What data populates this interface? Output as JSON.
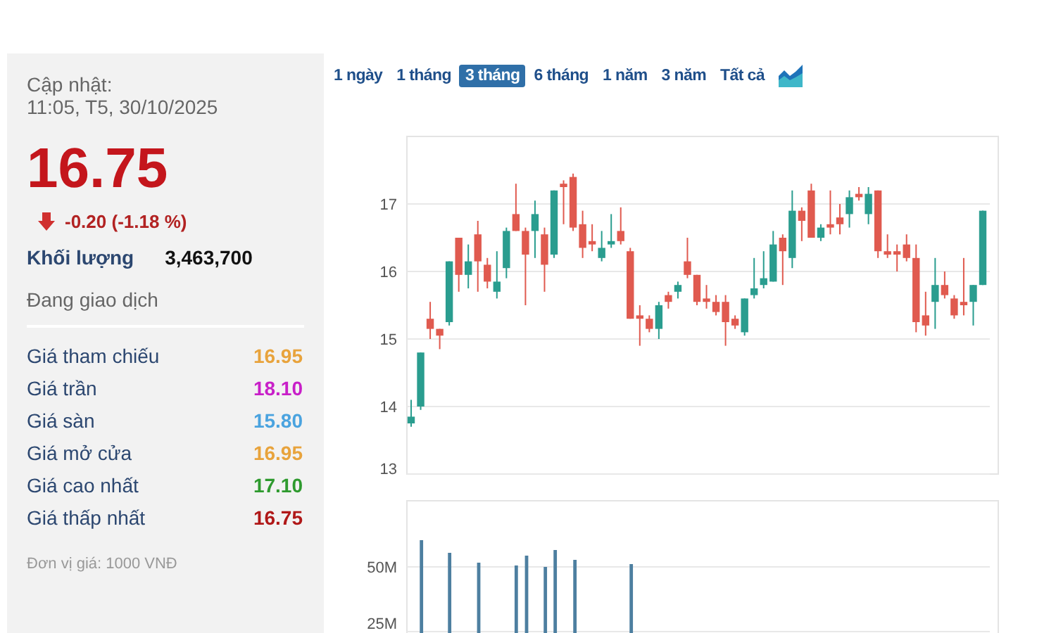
{
  "updated": {
    "label": "Cập nhật:",
    "time": "11:05, T5, 30/10/2025"
  },
  "price": "16.75",
  "change": {
    "falling": true,
    "text": "-0.20 (-1.18 %)"
  },
  "volume": {
    "label": "Khối lượng",
    "value": "3,463,700"
  },
  "status": "Đang giao dịch",
  "price_levels": [
    {
      "label": "Giá tham chiếu",
      "value": "16.95",
      "color": "#e8a33c"
    },
    {
      "label": "Giá trần",
      "value": "18.10",
      "color": "#c81fc8"
    },
    {
      "label": "Giá sàn",
      "value": "15.80",
      "color": "#4aa3df"
    },
    {
      "label": "Giá mở cửa",
      "value": "16.95",
      "color": "#e8a33c"
    },
    {
      "label": "Giá cao nhất",
      "value": "17.10",
      "color": "#2e9a2e"
    },
    {
      "label": "Giá thấp nhất",
      "value": "16.75",
      "color": "#b01818"
    }
  ],
  "unit_note": "Đơn vị giá: 1000 VNĐ",
  "range_tabs": [
    {
      "label": "1 ngày",
      "selected": false
    },
    {
      "label": "1 tháng",
      "selected": false
    },
    {
      "label": "3 tháng",
      "selected": true
    },
    {
      "label": "6 tháng",
      "selected": false
    },
    {
      "label": "1 năm",
      "selected": false
    },
    {
      "label": "3 năm",
      "selected": false
    },
    {
      "label": "Tất cả",
      "selected": false
    }
  ],
  "price_chart": {
    "chart_data": {
      "type": "candlestick",
      "grid": true,
      "yticks": [
        13,
        14,
        15,
        16,
        17
      ],
      "ylim": [
        13,
        18
      ],
      "ohlc": [
        [
          13.75,
          14.1,
          13.7,
          13.85
        ],
        [
          14.0,
          14.8,
          13.95,
          14.8
        ],
        [
          15.3,
          15.55,
          15.0,
          15.15
        ],
        [
          15.15,
          15.15,
          14.85,
          15.05
        ],
        [
          15.25,
          16.15,
          15.2,
          16.15
        ],
        [
          16.5,
          16.5,
          15.7,
          15.95
        ],
        [
          15.95,
          16.4,
          15.75,
          16.15
        ],
        [
          16.55,
          16.75,
          15.7,
          16.15
        ],
        [
          16.1,
          16.2,
          15.75,
          15.85
        ],
        [
          15.7,
          16.3,
          15.6,
          15.85
        ],
        [
          16.05,
          16.65,
          15.9,
          16.6
        ],
        [
          16.85,
          17.3,
          16.6,
          16.6
        ],
        [
          16.6,
          16.65,
          15.5,
          16.25
        ],
        [
          16.6,
          17.05,
          16.2,
          16.85
        ],
        [
          16.55,
          16.65,
          15.7,
          16.1
        ],
        [
          16.25,
          17.2,
          16.2,
          17.2
        ],
        [
          17.3,
          17.35,
          16.7,
          17.25
        ],
        [
          17.4,
          17.45,
          16.6,
          16.65
        ],
        [
          16.7,
          16.9,
          16.2,
          16.35
        ],
        [
          16.45,
          16.7,
          16.3,
          16.4
        ],
        [
          16.2,
          16.6,
          16.15,
          16.35
        ],
        [
          16.4,
          16.85,
          16.35,
          16.45
        ],
        [
          16.6,
          16.95,
          16.4,
          16.45
        ],
        [
          16.3,
          16.35,
          15.3,
          15.3
        ],
        [
          15.35,
          15.5,
          14.9,
          15.3
        ],
        [
          15.3,
          15.35,
          15.1,
          15.15
        ],
        [
          15.15,
          15.55,
          15.0,
          15.5
        ],
        [
          15.65,
          15.7,
          15.45,
          15.55
        ],
        [
          15.7,
          15.85,
          15.6,
          15.8
        ],
        [
          16.15,
          16.5,
          15.9,
          15.95
        ],
        [
          15.95,
          15.95,
          15.5,
          15.55
        ],
        [
          15.6,
          15.8,
          15.45,
          15.55
        ],
        [
          15.55,
          15.65,
          15.35,
          15.4
        ],
        [
          15.55,
          15.65,
          14.9,
          15.25
        ],
        [
          15.3,
          15.35,
          15.15,
          15.2
        ],
        [
          15.1,
          15.6,
          15.05,
          15.6
        ],
        [
          15.65,
          16.2,
          15.6,
          15.75
        ],
        [
          15.8,
          16.3,
          15.75,
          15.9
        ],
        [
          15.85,
          16.6,
          15.85,
          16.4
        ],
        [
          16.5,
          16.55,
          15.8,
          16.3
        ],
        [
          16.2,
          17.2,
          16.05,
          16.9
        ],
        [
          16.9,
          16.95,
          16.45,
          16.75
        ],
        [
          17.2,
          17.3,
          16.5,
          16.5
        ],
        [
          16.5,
          16.7,
          16.45,
          16.65
        ],
        [
          16.7,
          17.2,
          16.55,
          16.65
        ],
        [
          16.8,
          17.0,
          16.55,
          16.7
        ],
        [
          16.85,
          17.2,
          16.65,
          17.1
        ],
        [
          17.15,
          17.25,
          17.05,
          17.1
        ],
        [
          16.85,
          17.25,
          16.7,
          17.15
        ],
        [
          17.2,
          17.2,
          16.2,
          16.3
        ],
        [
          16.3,
          16.55,
          16.2,
          16.25
        ],
        [
          16.3,
          16.4,
          16.0,
          16.25
        ],
        [
          16.4,
          16.55,
          16.15,
          16.2
        ],
        [
          16.2,
          16.4,
          15.1,
          15.25
        ],
        [
          15.35,
          15.7,
          15.05,
          15.2
        ],
        [
          15.55,
          16.2,
          15.15,
          15.8
        ],
        [
          15.8,
          16.0,
          15.6,
          15.65
        ],
        [
          15.6,
          15.65,
          15.3,
          15.35
        ],
        [
          15.55,
          16.2,
          15.35,
          15.5
        ],
        [
          15.55,
          15.8,
          15.2,
          15.8
        ],
        [
          15.8,
          16.9,
          15.8,
          16.9
        ]
      ]
    }
  },
  "volume_chart": {
    "y_axis_labels": [
      "50M",
      "25M"
    ]
  }
}
